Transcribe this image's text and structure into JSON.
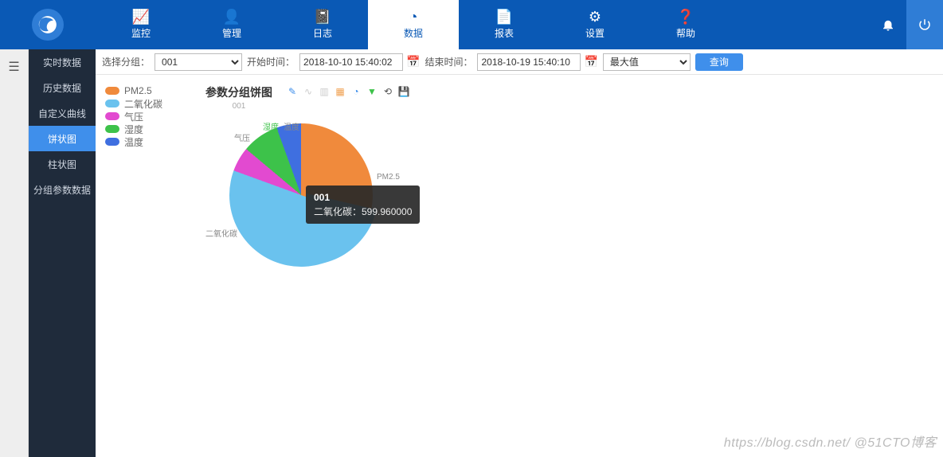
{
  "topnav": [
    {
      "icon": "chart",
      "label": "监控"
    },
    {
      "icon": "user",
      "label": "管理"
    },
    {
      "icon": "book",
      "label": "日志"
    },
    {
      "icon": "pie",
      "label": "数据",
      "active": true
    },
    {
      "icon": "doc",
      "label": "报表"
    },
    {
      "icon": "gear",
      "label": "设置"
    },
    {
      "icon": "help",
      "label": "帮助"
    }
  ],
  "sidebar": [
    {
      "label": "实时数据"
    },
    {
      "label": "历史数据"
    },
    {
      "label": "自定义曲线"
    },
    {
      "label": "饼状图",
      "active": true
    },
    {
      "label": "柱状图"
    },
    {
      "label": "分组参数数据"
    }
  ],
  "filter": {
    "group_label": "选择分组：",
    "group_value": "001",
    "start_label": "开始时间：",
    "start_value": "2018-10-10 15:40:02",
    "end_label": "结束时间：",
    "end_value": "2018-10-19 15:40:10",
    "agg_value": "最大值",
    "query": "查询"
  },
  "legend": [
    {
      "name": "PM2.5",
      "color": "#f08a3c"
    },
    {
      "name": "二氧化碳",
      "color": "#6ac2ee"
    },
    {
      "name": "气压",
      "color": "#e24ad0"
    },
    {
      "name": "湿度",
      "color": "#3dc24a"
    },
    {
      "name": "温度",
      "color": "#3f6fe0"
    }
  ],
  "chart": {
    "title": "参数分组饼图",
    "subtitle": "001",
    "labels": {
      "pm25": "PM2.5",
      "co2": "二氧化碳",
      "press": "气压",
      "humid": "湿度",
      "temp": "温度"
    },
    "tooltip": {
      "header": "001",
      "line": "二氧化碳：599.960000"
    }
  },
  "chart_data": {
    "type": "pie",
    "title": "参数分组饼图",
    "subtitle": "001",
    "series": [
      {
        "name": "PM2.5",
        "angle_deg": 110,
        "color": "#f08a3c"
      },
      {
        "name": "二氧化碳",
        "angle_deg": 180,
        "value": 599.96,
        "color": "#6ac2ee",
        "exploded": true
      },
      {
        "name": "气压",
        "angle_deg": 20,
        "color": "#e24ad0"
      },
      {
        "name": "湿度",
        "angle_deg": 30,
        "color": "#3dc24a"
      },
      {
        "name": "温度",
        "angle_deg": 20,
        "color": "#3f6fe0"
      }
    ],
    "aggregation": "最大值",
    "group": "001",
    "time_range": [
      "2018-10-10 15:40:02",
      "2018-10-19 15:40:10"
    ]
  },
  "toolbar_icons": [
    "edit",
    "line",
    "bar",
    "grid",
    "pie",
    "filter",
    "refresh",
    "save"
  ],
  "watermark": "https://blog.csdn.net/  @51CTO博客"
}
